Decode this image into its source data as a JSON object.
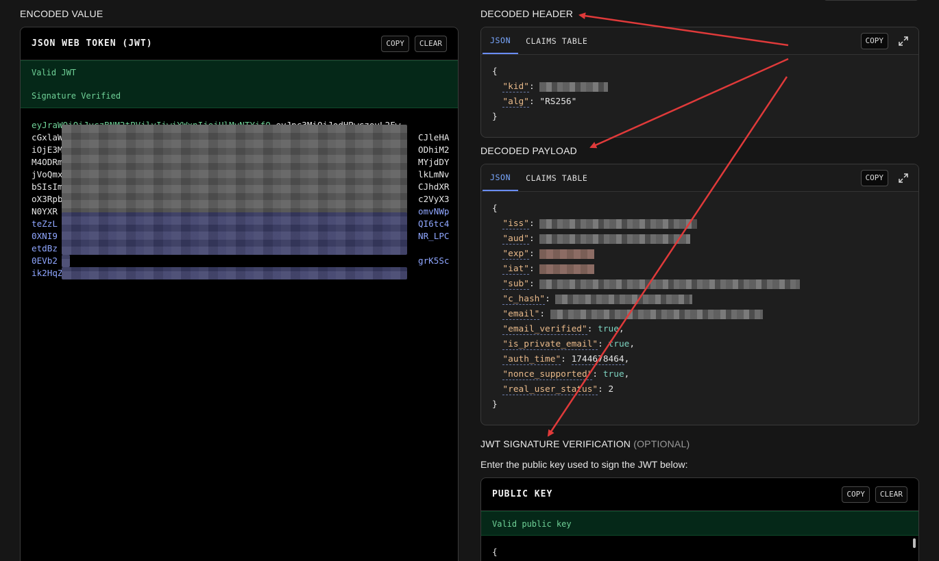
{
  "sections": {
    "encoded_title": "ENCODED VALUE",
    "decoded_header_title": "DECODED HEADER",
    "decoded_payload_title": "DECODED PAYLOAD",
    "sig_title": "JWT SIGNATURE VERIFICATION",
    "sig_optional": "(OPTIONAL)",
    "sig_helper": "Enter the public key used to sign the JWT below:"
  },
  "encoded": {
    "panel_title": "JSON WEB TOKEN (JWT)",
    "copy": "COPY",
    "clear": "CLEAR",
    "status_valid": "Valid JWT",
    "status_signature": "Signature Verified",
    "token_lines": [
      {
        "h": "eyJraWQiOiJvczBNM2tPVjlvIiwiYWxnIjoiUlMyNTYifQ",
        "p": ".eyJpc3MiOiJodHRwczovL2Fw",
        "s": ""
      },
      {
        "h": "",
        "p": "cGxlaW",
        "s": "",
        "tail": "CJleHA"
      },
      {
        "h": "",
        "p": "iOjE3M",
        "s": "",
        "tail": "ODhiM2"
      },
      {
        "h": "",
        "p": "M4ODRm",
        "s": "",
        "tail": "MYjdDY"
      },
      {
        "h": "",
        "p": "jVoQmx",
        "s": "",
        "tail": "lkLmNv"
      },
      {
        "h": "",
        "p": "bSIsIm",
        "s": "",
        "tail": "CJhdXR"
      },
      {
        "h": "",
        "p": "oX3Rpb",
        "s": "",
        "tail": "c2VyX3"
      },
      {
        "h": "",
        "p": "N0YXR",
        "s": "",
        "tail": "omvNWp",
        "tailSig": true
      },
      {
        "h": "",
        "p": "",
        "s": "teZzL",
        "tail": "QI6tc4",
        "tailSig": true
      },
      {
        "h": "",
        "p": "",
        "s": "0XNI9",
        "tail": "NR_LPC",
        "tailSig": true
      },
      {
        "h": "",
        "p": "",
        "s": "etdBz",
        "tail": "",
        "tailSig": true
      },
      {
        "h": "",
        "p": "",
        "s": "0EVb2",
        "tail": "grK5Sc",
        "tailSig": true
      },
      {
        "h": "",
        "p": "",
        "s": "ik2HqZPzchjV-Ze3snSsJBMarXxNOWMVyZvsG6q-IfpdeKQxLScUaRsovSaxIQkBg",
        "tail": ""
      }
    ]
  },
  "header_card": {
    "tab_json": "JSON",
    "tab_claims": "CLAIMS TABLE",
    "copy": "COPY",
    "kid_key": "\"kid\"",
    "alg_key": "\"alg\"",
    "alg_value": "\"RS256\""
  },
  "payload_card": {
    "tab_json": "JSON",
    "tab_claims": "CLAIMS TABLE",
    "copy": "COPY",
    "keys": {
      "iss": "\"iss\"",
      "aud": "\"aud\"",
      "exp": "\"exp\"",
      "iat": "\"iat\"",
      "sub": "\"sub\"",
      "c_hash": "\"c_hash\"",
      "email": "\"email\"",
      "email_verified": "\"email_verified\"",
      "is_private_email": "\"is_private_email\"",
      "auth_time": "\"auth_time\"",
      "nonce_supported": "\"nonce_supported\"",
      "real_user_status": "\"real_user_status\""
    },
    "values": {
      "email_verified": "true",
      "is_private_email": "true",
      "auth_time": "1744678464",
      "nonce_supported": "true",
      "real_user_status": "2"
    }
  },
  "public_key": {
    "panel_title": "PUBLIC KEY",
    "copy": "COPY",
    "clear": "CLEAR",
    "status_valid": "Valid public key",
    "body_first": "{"
  },
  "colors": {
    "arrow": "#e03a3a",
    "valid_green": "#6fd197",
    "tab_active": "#7aa8ff"
  }
}
